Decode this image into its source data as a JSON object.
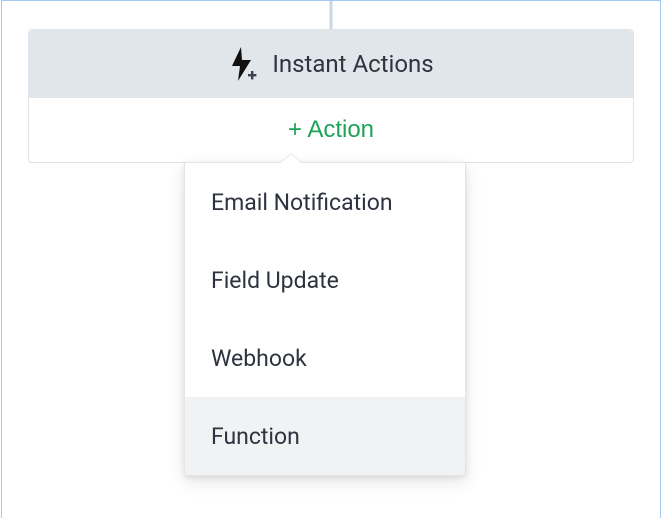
{
  "card": {
    "title": "Instant Actions",
    "add_label": "+ Action"
  },
  "menu": {
    "items": [
      {
        "label": "Email Notification"
      },
      {
        "label": "Field Update"
      },
      {
        "label": "Webhook"
      },
      {
        "label": "Function"
      }
    ],
    "hovered_index": 3
  }
}
